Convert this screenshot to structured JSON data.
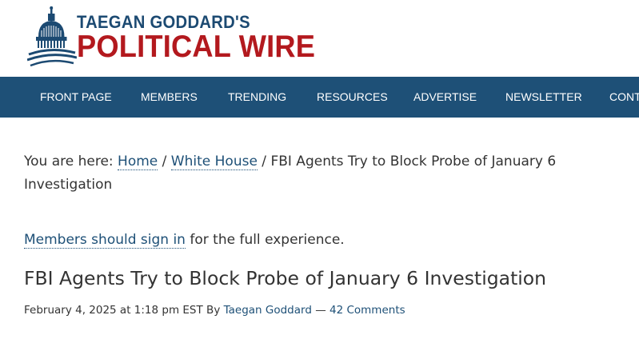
{
  "logo": {
    "line1": "TAEGAN GODDARD'S",
    "line2": "POLITICAL WIRE",
    "icon": "capitol-dome-icon",
    "colors": {
      "blue": "#1c4a72",
      "red": "#b3191e"
    }
  },
  "nav": {
    "background": "#1e5077",
    "items": [
      "FRONT PAGE",
      "MEMBERS",
      "TRENDING",
      "RESOURCES",
      "ADVERTISE",
      "NEWSLETTER",
      "CONTACT"
    ]
  },
  "breadcrumb": {
    "prefix": "You are here: ",
    "home": "Home",
    "sep1": " / ",
    "section": "White House",
    "sep2": " / ",
    "current": "FBI Agents Try to Block Probe of January 6 Investigation"
  },
  "members_note": {
    "link": "Members should sign in",
    "text": " for the full experience."
  },
  "article": {
    "title": "FBI Agents Try to Block Probe of January 6 Investigation",
    "date": "February 4, 2025 at 1:18 pm EST",
    "by": " By ",
    "author": "Taegan Goddard",
    "dash": " — ",
    "comments": "42 Comments"
  }
}
